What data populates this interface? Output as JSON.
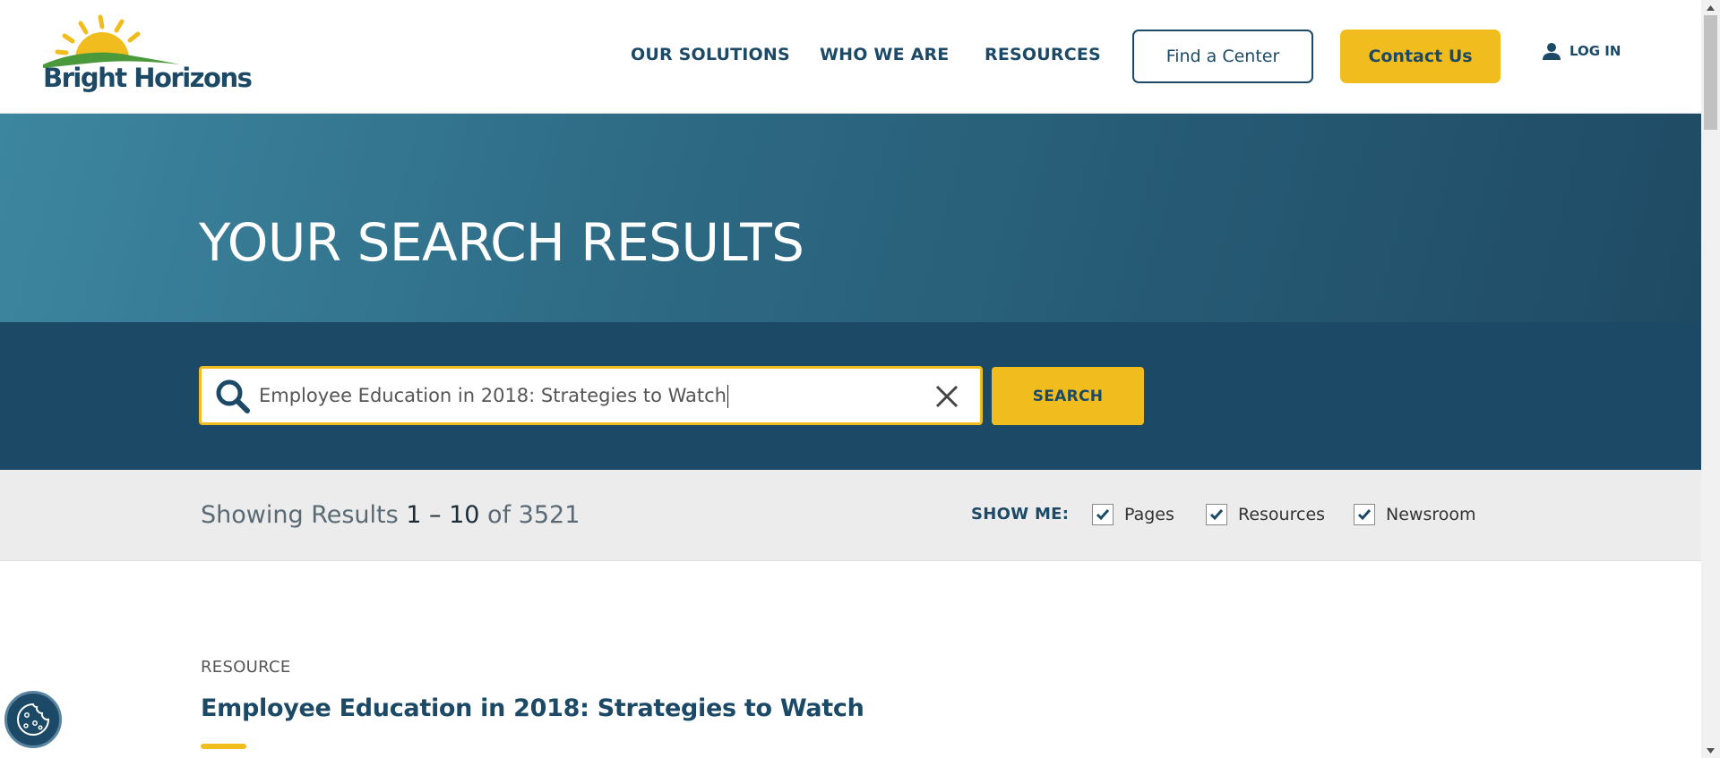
{
  "header": {
    "logo_text": "Bright Horizons",
    "logo_tm": "TM",
    "nav": [
      "OUR SOLUTIONS",
      "WHO WE ARE",
      "RESOURCES"
    ],
    "find_center_label": "Find a Center",
    "contact_label": "Contact Us",
    "login_label": "LOG IN"
  },
  "hero": {
    "title": "YOUR SEARCH RESULTS"
  },
  "search": {
    "query": "Employee Education in 2018: Strategies to Watch",
    "button_label": "SEARCH"
  },
  "filters": {
    "results_prefix": "Showing Results ",
    "results_range": "1 – 10",
    "results_of": " of ",
    "results_total": "3521",
    "show_me_label": "SHOW ME:",
    "options": [
      {
        "label": "Pages",
        "checked": true
      },
      {
        "label": "Resources",
        "checked": true
      },
      {
        "label": "Newsroom",
        "checked": true
      }
    ]
  },
  "results": [
    {
      "type": "RESOURCE",
      "title": "Employee Education in 2018: Strategies to Watch"
    }
  ],
  "colors": {
    "brand_navy": "#1c4a66",
    "brand_yellow": "#f0bc1e",
    "logo_green": "#4a9a3c"
  }
}
